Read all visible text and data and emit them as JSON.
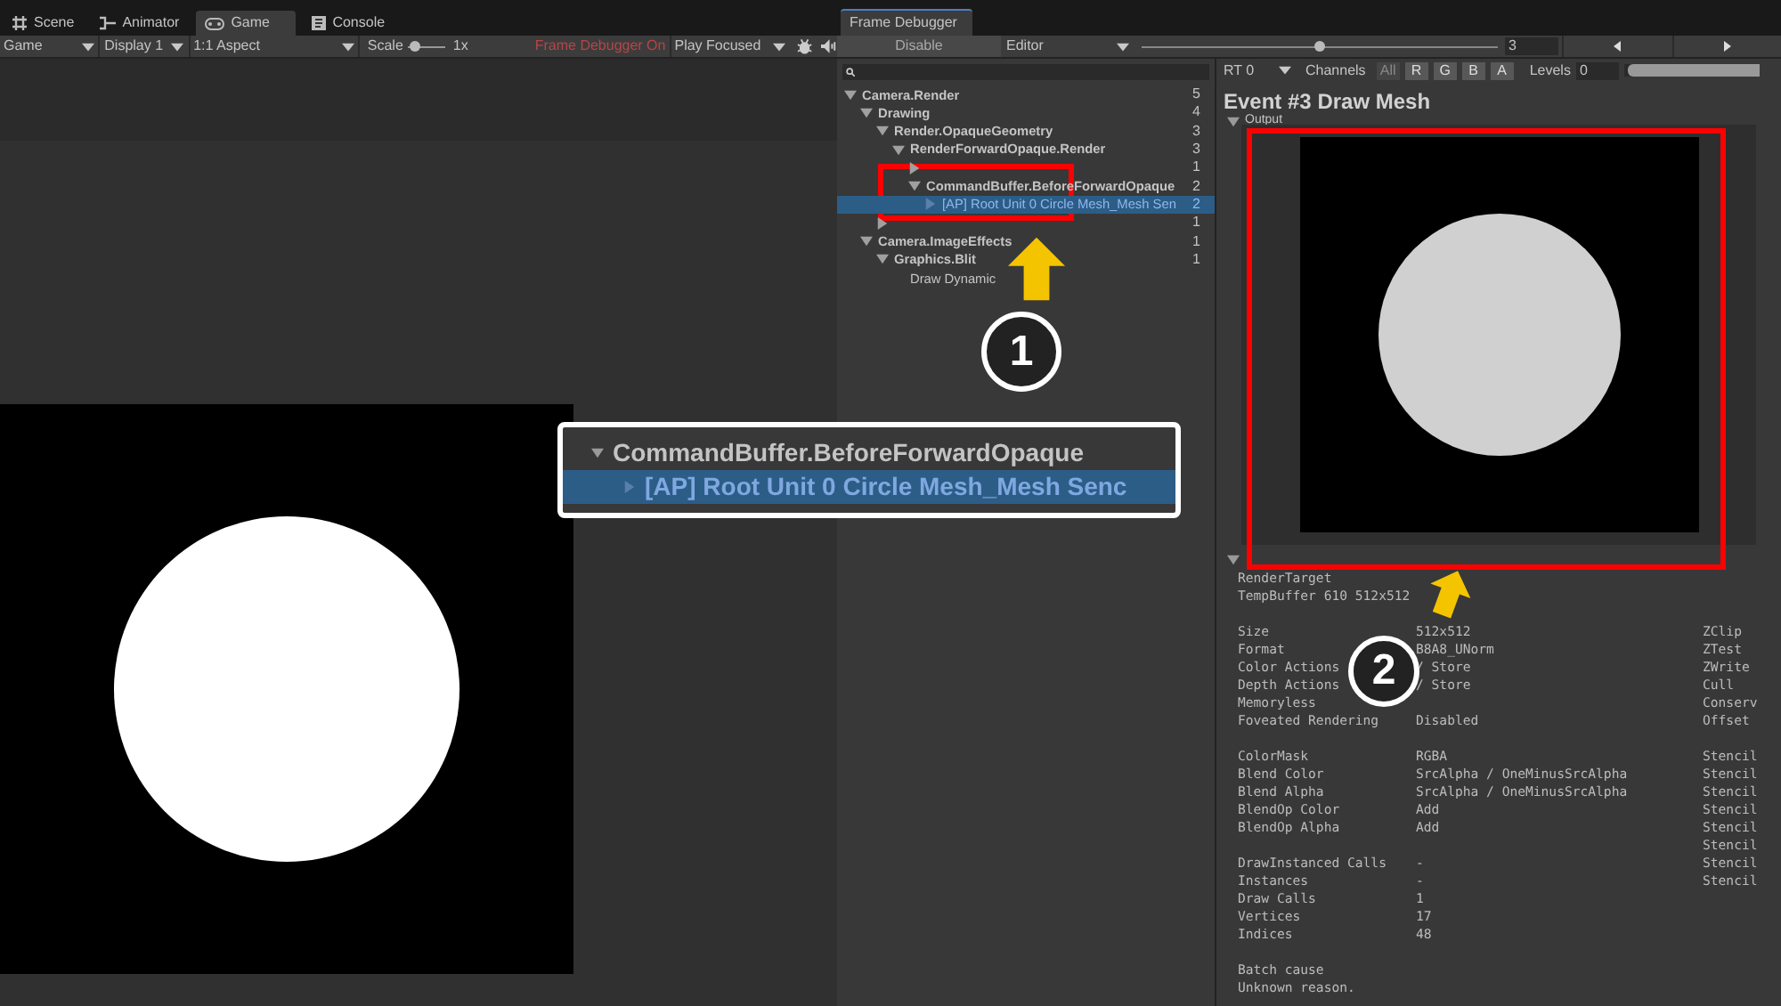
{
  "left_tabs": [
    {
      "label": "Scene",
      "selected": false
    },
    {
      "label": "Animator",
      "selected": false
    },
    {
      "label": "Game",
      "selected": true
    },
    {
      "label": "Console",
      "selected": false
    }
  ],
  "game_toolbar": {
    "display_mode": "Game",
    "display": "Display 1",
    "aspect": "1:1 Aspect",
    "scale_label": "Scale",
    "scale_value": "1x",
    "scale": {
      "level": 0.15
    },
    "frame_debugger_status": "Frame Debugger On",
    "play_mode": "Play Focused"
  },
  "debugger_tab": {
    "label": "Frame Debugger",
    "selected": true
  },
  "debugger_toolbar": {
    "disable": "Disable",
    "target": "Editor",
    "event_slider": {
      "level": 0.5
    },
    "event_index": "3"
  },
  "tree": [
    {
      "label": "Camera.Render",
      "count": "5",
      "expanded": true,
      "selected": false,
      "children": [
        {
          "label": "Drawing",
          "count": "4",
          "expanded": true,
          "selected": false,
          "children": [
            {
              "label": "Render.OpaqueGeometry",
              "count": "3",
              "expanded": true,
              "selected": false,
              "children": [
                {
                  "label": "RenderForwardOpaque.Render",
                  "count": "3",
                  "expanded": true,
                  "selected": false,
                  "children": [
                    {
                      "count": "1",
                      "expanded": false,
                      "selected": false
                    },
                    {
                      "label": "CommandBuffer.BeforeForwardOpaque",
                      "count": "2",
                      "expanded": true,
                      "selected": false,
                      "children": [
                        {
                          "label": "[AP] Root Unit 0 Circle Mesh_Mesh Sen",
                          "count": "2",
                          "expanded": false,
                          "selected": true
                        }
                      ]
                    }
                  ]
                }
              ]
            },
            {
              "count": "1",
              "expanded": false,
              "selected": false
            }
          ]
        },
        {
          "label": "Camera.ImageEffects",
          "count": "1",
          "expanded": true,
          "selected": false,
          "children": [
            {
              "label": "Graphics.Blit",
              "count": "1",
              "expanded": true,
              "selected": false,
              "children": [
                {
                  "label": "Draw Dynamic"
                }
              ]
            }
          ]
        }
      ]
    }
  ],
  "preview_toolbar": {
    "render_target": "RT 0",
    "channels_label": "Channels",
    "channels": [
      {
        "label": "All",
        "selected": true
      },
      {
        "label": "R",
        "selected": false
      },
      {
        "label": "G",
        "selected": false
      },
      {
        "label": "B",
        "selected": false
      },
      {
        "label": "A",
        "selected": false
      }
    ],
    "levels_label": "Levels",
    "levels_value": "0",
    "levels": {
      "level": 0.98
    }
  },
  "event_title": "Event #3 Draw Mesh",
  "output_header": "Output",
  "details": [
    {
      "kind": "row",
      "label": "RenderTarget"
    },
    {
      "kind": "row",
      "label": "TempBuffer 610 512x512"
    },
    {
      "kind": "gap"
    },
    {
      "kind": "row",
      "label": "Size",
      "value": "512x512",
      "right": "ZClip"
    },
    {
      "kind": "row",
      "label": "Format",
      "value": "B8A8_UNorm",
      "right": "ZTest"
    },
    {
      "kind": "row",
      "label": "Color Actions",
      "value": "/ Store",
      "right": "ZWrite"
    },
    {
      "kind": "row",
      "label": "Depth Actions",
      "value": "/ Store",
      "right": "Cull"
    },
    {
      "kind": "row",
      "label": "Memoryless",
      "right": "Conserv"
    },
    {
      "kind": "row",
      "label": "Foveated Rendering",
      "value": "Disabled",
      "right": "Offset"
    },
    {
      "kind": "gap"
    },
    {
      "kind": "row",
      "label": "ColorMask",
      "value": "RGBA",
      "right": "Stencil"
    },
    {
      "kind": "row",
      "label": "Blend Color",
      "value": "SrcAlpha / OneMinusSrcAlpha",
      "right": "Stencil"
    },
    {
      "kind": "row",
      "label": "Blend Alpha",
      "value": "SrcAlpha / OneMinusSrcAlpha",
      "right": "Stencil"
    },
    {
      "kind": "row",
      "label": "BlendOp Color",
      "value": "Add",
      "right": "Stencil"
    },
    {
      "kind": "row",
      "label": "BlendOp Alpha",
      "value": "Add",
      "right": "Stencil"
    },
    {
      "kind": "row",
      "right": "Stencil"
    },
    {
      "kind": "row",
      "label": "DrawInstanced Calls",
      "value": "-",
      "right": "Stencil"
    },
    {
      "kind": "row",
      "label": "Instances",
      "value": "-",
      "right": "Stencil"
    },
    {
      "kind": "row",
      "label": "Draw Calls",
      "value": "1"
    },
    {
      "kind": "row",
      "label": "Vertices",
      "value": "17"
    },
    {
      "kind": "row",
      "label": "Indices",
      "value": "48"
    },
    {
      "kind": "gap"
    },
    {
      "kind": "row",
      "label": "Batch cause"
    },
    {
      "kind": "row",
      "label": "Unknown reason."
    }
  ],
  "callout": {
    "rows": [
      {
        "label": "CommandBuffer.BeforeForwardOpaque",
        "expanded": true,
        "selected": false
      },
      {
        "label": "[AP] Root Unit 0 Circle Mesh_Mesh Senc",
        "expanded": false,
        "selected": true
      }
    ]
  },
  "markers": [
    {
      "number": "1"
    },
    {
      "number": "2"
    }
  ]
}
